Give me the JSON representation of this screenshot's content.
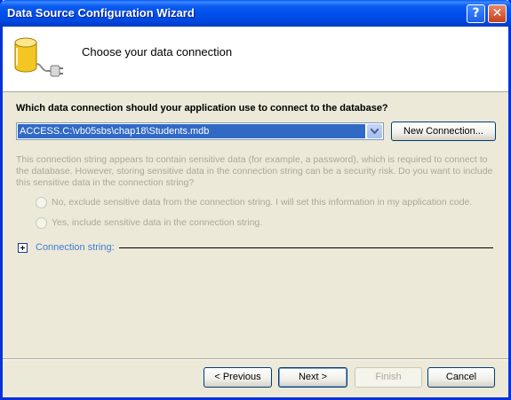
{
  "window": {
    "title": "Data Source Configuration Wizard",
    "help_glyph": "?",
    "close_glyph": "✕"
  },
  "header": {
    "title": "Choose your data connection",
    "icon": "database-plug-icon"
  },
  "question": "Which data connection should your application use to connect to the database?",
  "connection_combo": {
    "selected": "ACCESS.C:\\vb05sbs\\chap18\\Students.mdb"
  },
  "buttons": {
    "new_connection": "New Connection...",
    "previous": "< Previous",
    "next": "Next >",
    "finish": "Finish",
    "cancel": "Cancel"
  },
  "sensitive_notice": "This connection string appears to contain sensitive data (for example, a password), which is required to connect to the database. However, storing sensitive data in the connection string can be a security risk. Do you want to include this sensitive data in the connection string?",
  "radios": [
    {
      "label": "No, exclude sensitive data from the connection string. I will set this information in my application code.",
      "enabled": false
    },
    {
      "label": "Yes, include sensitive data in the connection string.",
      "enabled": false
    }
  ],
  "connection_string_label": "Connection string:",
  "colors": {
    "titlebar": "#0050ee",
    "dialog_bg": "#ece9d8",
    "selection": "#316ac5",
    "link": "#3c7ed5",
    "disabled_text": "#aca899"
  }
}
